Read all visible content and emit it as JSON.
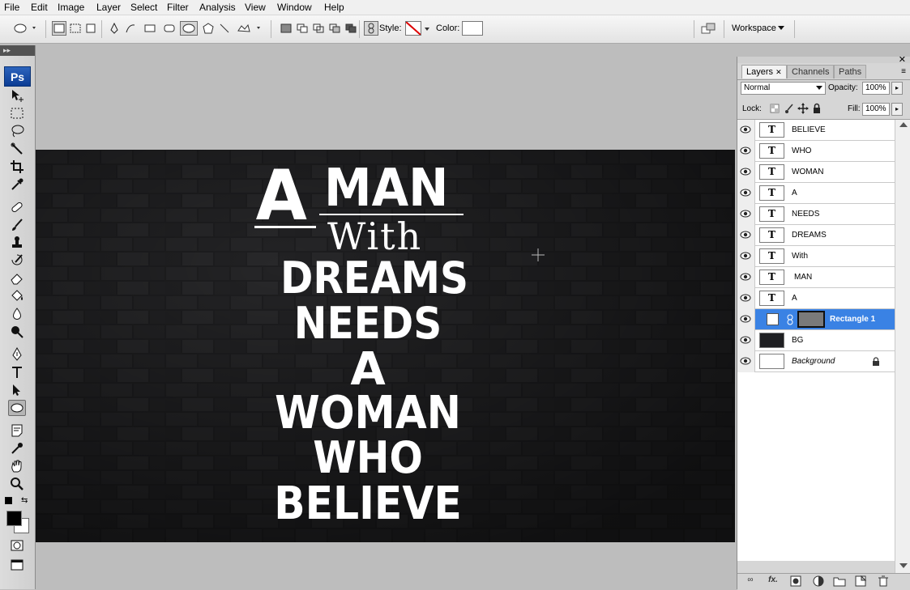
{
  "menu": [
    "File",
    "Edit",
    "Image",
    "Layer",
    "Select",
    "Filter",
    "Analysis",
    "View",
    "Window",
    "Help"
  ],
  "options_bar": {
    "style_label": "Style:",
    "color_label": "Color:",
    "workspace_label": "Workspace",
    "color_swatch": "#ffffff"
  },
  "toolbox": {
    "logo": "Ps",
    "foreground_color": "#000000",
    "background_color": "#ffffff"
  },
  "poster": {
    "line1_big": "A",
    "line1_word": "MAN",
    "line2": "With",
    "line3": "DREAMS",
    "line4": "NEEDS",
    "line5": "A",
    "line6": "WOMAN",
    "line7": "WHO",
    "line8": "BELIEVE"
  },
  "layers_panel": {
    "tabs": [
      "Layers",
      "Channels",
      "Paths"
    ],
    "blend_mode": "Normal",
    "opacity_label": "Opacity:",
    "opacity_value": "100%",
    "lock_label": "Lock:",
    "fill_label": "Fill:",
    "fill_value": "100%",
    "layers": [
      {
        "name": "BELIEVE",
        "type": "text"
      },
      {
        "name": "WHO",
        "type": "text"
      },
      {
        "name": "WOMAN",
        "type": "text"
      },
      {
        "name": "A",
        "type": "text"
      },
      {
        "name": "NEEDS",
        "type": "text"
      },
      {
        "name": "DREAMS",
        "type": "text"
      },
      {
        "name": "With",
        "type": "text"
      },
      {
        "name": "MAN",
        "type": "text"
      },
      {
        "name": "A",
        "type": "text"
      },
      {
        "name": "Rectangle 1",
        "type": "shape",
        "selected": true
      },
      {
        "name": "BG",
        "type": "image"
      },
      {
        "name": "Background",
        "type": "background"
      }
    ],
    "bottom_fx": "fx."
  }
}
